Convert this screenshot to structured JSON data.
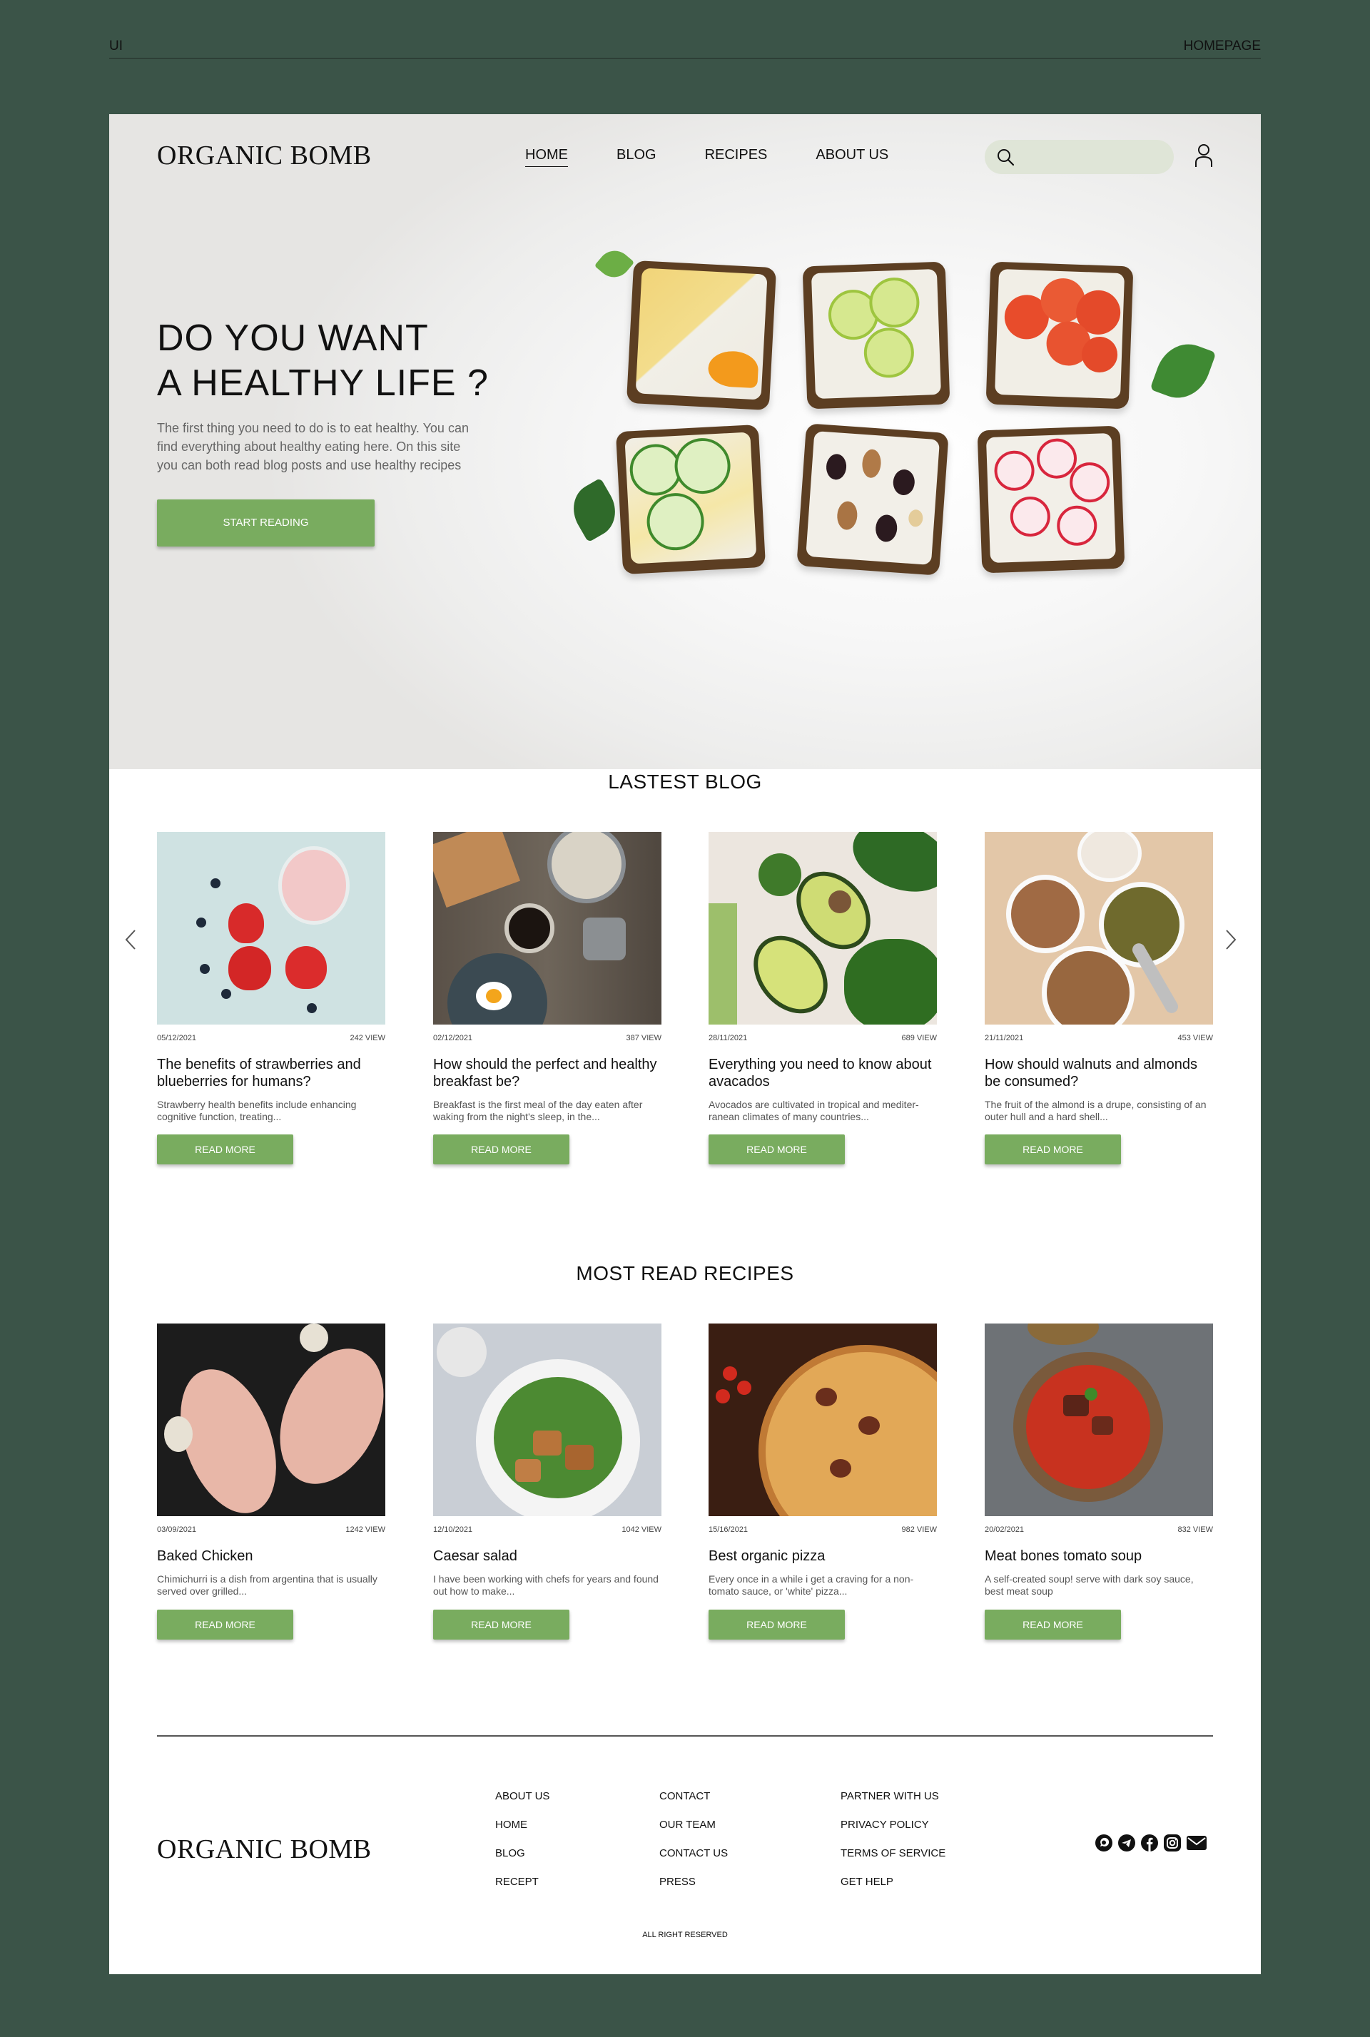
{
  "frame": {
    "left_label": "UI",
    "right_label": "HOMEPAGE"
  },
  "brand": "ORGANIC BOMB",
  "nav": [
    {
      "label": "HOME",
      "active": true
    },
    {
      "label": "BLOG",
      "active": false
    },
    {
      "label": "RECIPES",
      "active": false
    },
    {
      "label": "ABOUT US",
      "active": false
    }
  ],
  "search": {
    "placeholder": ""
  },
  "hero": {
    "title": "DO YOU WANT\nA HEALTHY LIFE ?",
    "description": "The first thing you need to do is to eat healthy. You can find everything about healthy eating here. On this site you can both read blog posts and use healthy recipes",
    "cta": "START READING"
  },
  "blog": {
    "title": "LASTEST BLOG",
    "posts": [
      {
        "date": "05/12/2021",
        "views": "242 VIEW",
        "title": "The benefits of  strawberries and blueberries for humans?",
        "excerpt": "Strawberry health benefits include enhancing cognitive function, treating...",
        "cta": "READ MORE"
      },
      {
        "date": "02/12/2021",
        "views": "387 VIEW",
        "title": "How should the perfect and healthy breakfast be?",
        "excerpt": "Breakfast is the first meal of the day eaten after waking from the night's sleep, in the...",
        "cta": "READ MORE"
      },
      {
        "date": "28/11/2021",
        "views": "689 VIEW",
        "title": "Everything you need to know about avacados",
        "excerpt": "Avocados are cultivated in tropical and mediter-ranean climates of many countries...",
        "cta": "READ MORE"
      },
      {
        "date": "21/11/2021",
        "views": "453 VIEW",
        "title": "How should walnuts and almonds be consumed?",
        "excerpt": "The fruit of the almond is a drupe, consisting of an outer hull and a hard shell...",
        "cta": "READ MORE"
      }
    ]
  },
  "recipes": {
    "title": "MOST READ RECIPES",
    "items": [
      {
        "date": "03/09/2021",
        "views": "1242 VIEW",
        "title": "Baked Chicken",
        "excerpt": "Chimichurri is a dish from argentina that is usually served over grilled...",
        "cta": "READ MORE"
      },
      {
        "date": "12/10/2021",
        "views": "1042 VIEW",
        "title": "Caesar salad",
        "excerpt": "I have been working with chefs for years and found out how to make...",
        "cta": "READ MORE"
      },
      {
        "date": "15/16/2021",
        "views": "982 VIEW",
        "title": "Best organic pizza",
        "excerpt": "Every once in a while i get a craving for a non-tomato sauce, or 'white' pizza...",
        "cta": "READ MORE"
      },
      {
        "date": "20/02/2021",
        "views": "832 VIEW",
        "title": "Meat bones tomato soup",
        "excerpt": "A self-created soup! serve with dark soy sauce, best meat soup",
        "cta": "READ MORE"
      }
    ]
  },
  "footer": {
    "columns": [
      [
        "ABOUT US",
        "HOME",
        "BLOG",
        "RECEPT"
      ],
      [
        "CONTACT",
        "OUR TEAM",
        "CONTACT US",
        "PRESS"
      ],
      [
        "PARTNER WITH US",
        "PRIVACY POLICY",
        "TERMS OF SERVICE",
        "GET HELP"
      ]
    ],
    "social": [
      "whatsapp-icon",
      "telegram-icon",
      "facebook-icon",
      "instagram-icon",
      "mail-icon"
    ],
    "rights": "ALL RIGHT RESERVED"
  },
  "colors": {
    "accent": "#79ac5f",
    "frame": "#3b5448",
    "search": "#dfe5d7"
  }
}
